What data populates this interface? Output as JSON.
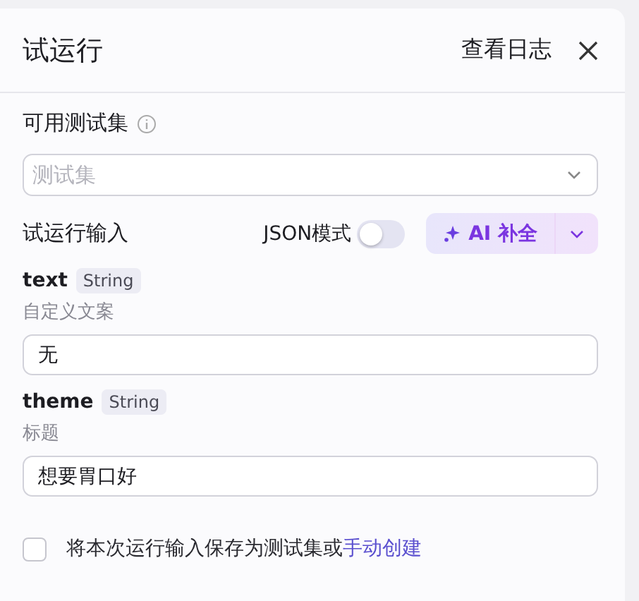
{
  "header": {
    "title": "试运行",
    "log_link": "查看日志"
  },
  "test_set": {
    "label": "可用测试集",
    "placeholder": "测试集"
  },
  "input_section": {
    "label": "试运行输入",
    "json_mode": {
      "label": "JSON模式",
      "on": false
    },
    "ai_button": "AI 补全"
  },
  "params": [
    {
      "name": "text",
      "type": "String",
      "description": "自定义文案",
      "value": "无"
    },
    {
      "name": "theme",
      "type": "String",
      "description": "标题",
      "value": "想要胃口好"
    }
  ],
  "save_option": {
    "checked": false,
    "text": "将本次运行输入保存为测试集或",
    "link": "手动创建"
  }
}
